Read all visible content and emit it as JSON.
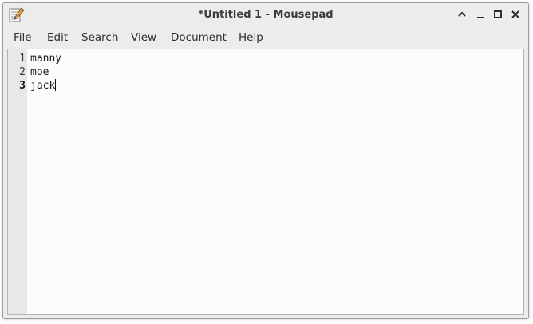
{
  "window": {
    "title": "*Untitled 1 - Mousepad",
    "app_icon": "text-editor-icon",
    "controls": [
      "minimize-up-icon",
      "minimize-icon",
      "maximize-icon",
      "close-icon"
    ]
  },
  "menubar": {
    "items": [
      {
        "label": "File"
      },
      {
        "label": "Edit"
      },
      {
        "label": "Search"
      },
      {
        "label": "View"
      },
      {
        "label": "Document"
      },
      {
        "label": "Help"
      }
    ]
  },
  "editor": {
    "line_numbers": [
      "1",
      "2",
      "3"
    ],
    "current_line": 3,
    "lines": [
      "manny",
      "moe",
      "jack"
    ]
  },
  "colors": {
    "chrome": "#ececec",
    "editor_bg": "#fcfcfc",
    "gutter_bg": "#e8e8e8"
  }
}
